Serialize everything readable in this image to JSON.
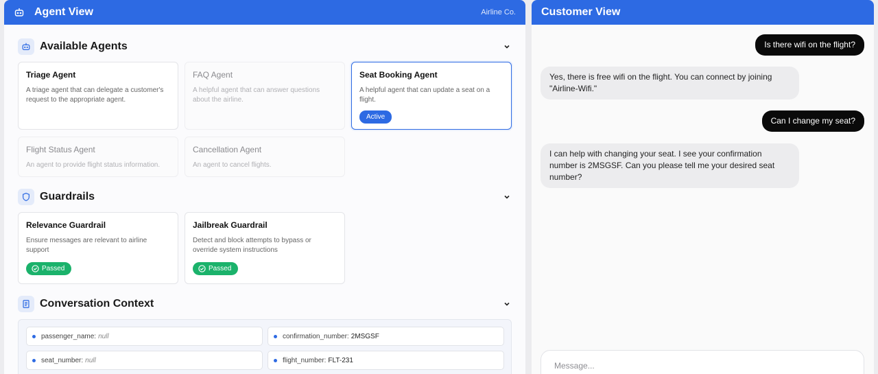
{
  "agent_view": {
    "title": "Agent View",
    "org": "Airline Co.",
    "header_icon": "robot-icon"
  },
  "sections": {
    "agents": {
      "title": "Available Agents",
      "icon": "robot-icon"
    },
    "guardrails": {
      "title": "Guardrails",
      "icon": "shield-icon"
    },
    "context": {
      "title": "Conversation Context",
      "icon": "document-icon"
    }
  },
  "agents": [
    {
      "name": "Triage Agent",
      "desc": "A triage agent that can delegate a customer's request to the appropriate agent."
    },
    {
      "name": "FAQ Agent",
      "desc": "A helpful agent that can answer questions about the airline."
    },
    {
      "name": "Seat Booking Agent",
      "desc": "A helpful agent that can update a seat on a flight.",
      "badge": "Active"
    },
    {
      "name": "Flight Status Agent",
      "desc": "An agent to provide flight status information."
    },
    {
      "name": "Cancellation Agent",
      "desc": "An agent to cancel flights."
    }
  ],
  "guardrails": [
    {
      "name": "Relevance Guardrail",
      "desc": "Ensure messages are relevant to airline support",
      "status": "Passed"
    },
    {
      "name": "Jailbreak Guardrail",
      "desc": "Detect and block attempts to bypass or override system instructions",
      "status": "Passed"
    }
  ],
  "context": [
    {
      "key": "passenger_name:",
      "value": "null"
    },
    {
      "key": "confirmation_number:",
      "value": "2MSGSF"
    },
    {
      "key": "seat_number:",
      "value": "null"
    },
    {
      "key": "flight_number:",
      "value": "FLT-231"
    }
  ],
  "customer_view": {
    "title": "Customer View",
    "messages": [
      {
        "role": "user",
        "text": "Is there wifi on the flight?"
      },
      {
        "role": "assistant",
        "text": "Yes, there is free wifi on the flight. You can connect by joining \"Airline-Wifi.\""
      },
      {
        "role": "user",
        "text": "Can I change my seat?"
      },
      {
        "role": "assistant",
        "text": "I can help with changing your seat. I see your confirmation number is 2MSGSF. Can you please tell me your desired seat number?"
      }
    ],
    "composer_placeholder": "Message..."
  },
  "colors": {
    "accent": "#2d6ae3",
    "passed": "#1bb26b",
    "user_bubble": "#0a0a0a"
  }
}
